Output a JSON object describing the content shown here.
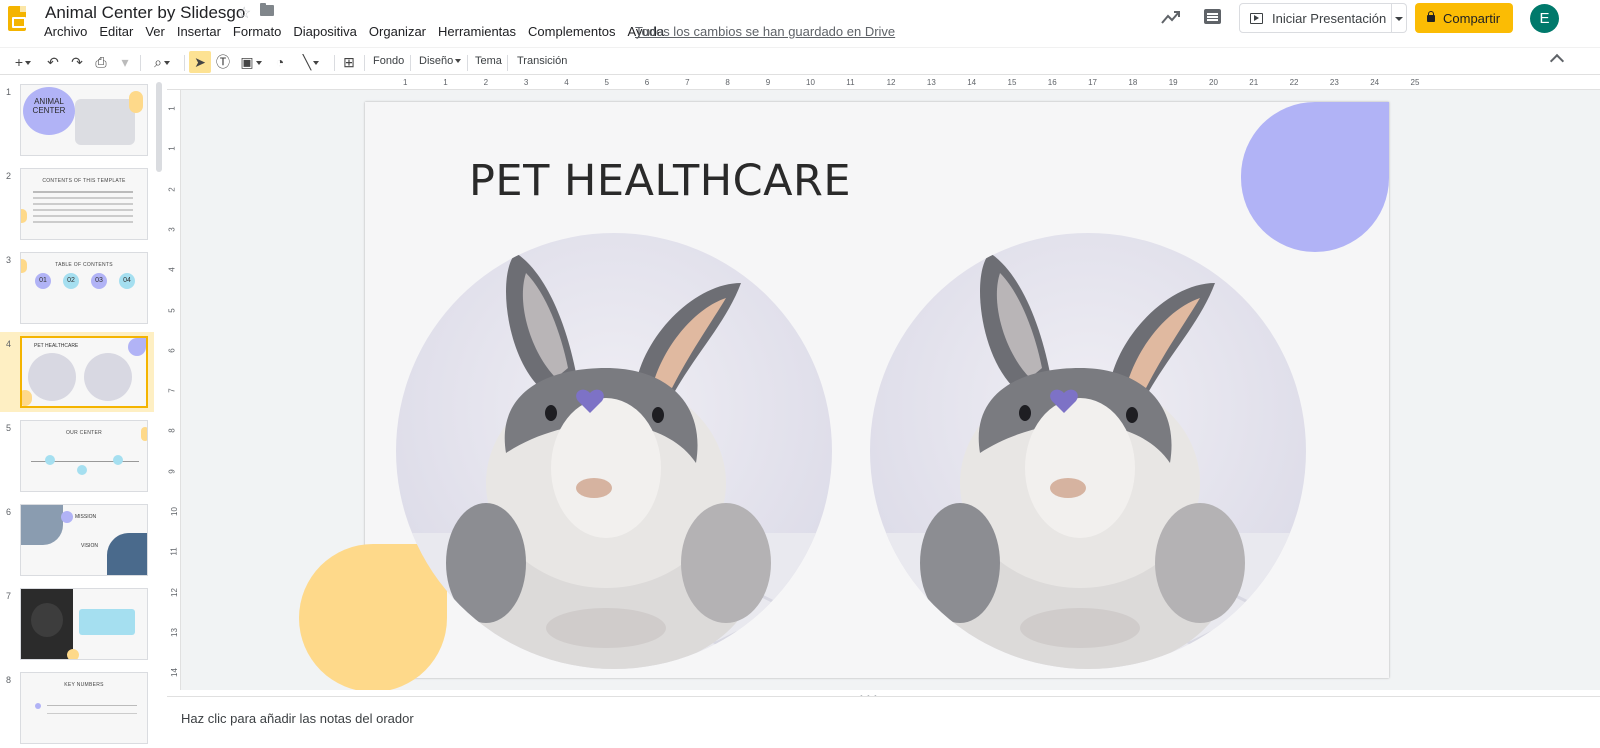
{
  "app": {
    "doc_title": "Animal Center by Slidesgo",
    "menu": [
      "Archivo",
      "Editar",
      "Ver",
      "Insertar",
      "Formato",
      "Diapositiva",
      "Organizar",
      "Herramientas",
      "Complementos",
      "Ayuda"
    ],
    "save_status": "Todos los cambios se han guardado en Drive",
    "present_label": "Iniciar Presentación",
    "share_label": "Compartir",
    "avatar_initial": "E"
  },
  "toolbar": {
    "background_label": "Fondo",
    "layout_label": "Diseño",
    "theme_label": "Tema",
    "transition_label": "Transición"
  },
  "ruler": {
    "h_ticks": [
      "1",
      "1",
      "2",
      "3",
      "4",
      "5",
      "6",
      "7",
      "8",
      "9",
      "10",
      "11",
      "12",
      "13",
      "14",
      "15",
      "16",
      "17",
      "18",
      "19",
      "20",
      "21",
      "22",
      "23",
      "24",
      "25"
    ],
    "v_ticks": [
      "1",
      "1",
      "2",
      "3",
      "4",
      "5",
      "6",
      "7",
      "8",
      "9",
      "10",
      "11",
      "12",
      "13",
      "14"
    ]
  },
  "filmstrip": {
    "slides": [
      {
        "num": "1",
        "title": "ANIMAL CENTER"
      },
      {
        "num": "2",
        "title": "CONTENTS OF THIS TEMPLATE"
      },
      {
        "num": "3",
        "title": "TABLE OF CONTENTS"
      },
      {
        "num": "4",
        "title": "PET HEALTHCARE"
      },
      {
        "num": "5",
        "title": "OUR CENTER"
      },
      {
        "num": "6",
        "title": "MISSION"
      },
      {
        "num": "7",
        "title": ""
      },
      {
        "num": "8",
        "title": "KEY NUMBERS"
      }
    ],
    "thumb3_numbers": [
      "01",
      "02",
      "03",
      "04"
    ],
    "thumb6_sub": "VISION"
  },
  "slide": {
    "title": "PET HEALTHCARE",
    "purple": "#b1b3f6",
    "yellow": "#fed98a"
  },
  "notes": {
    "placeholder": "Haz clic para añadir las notas del orador"
  }
}
